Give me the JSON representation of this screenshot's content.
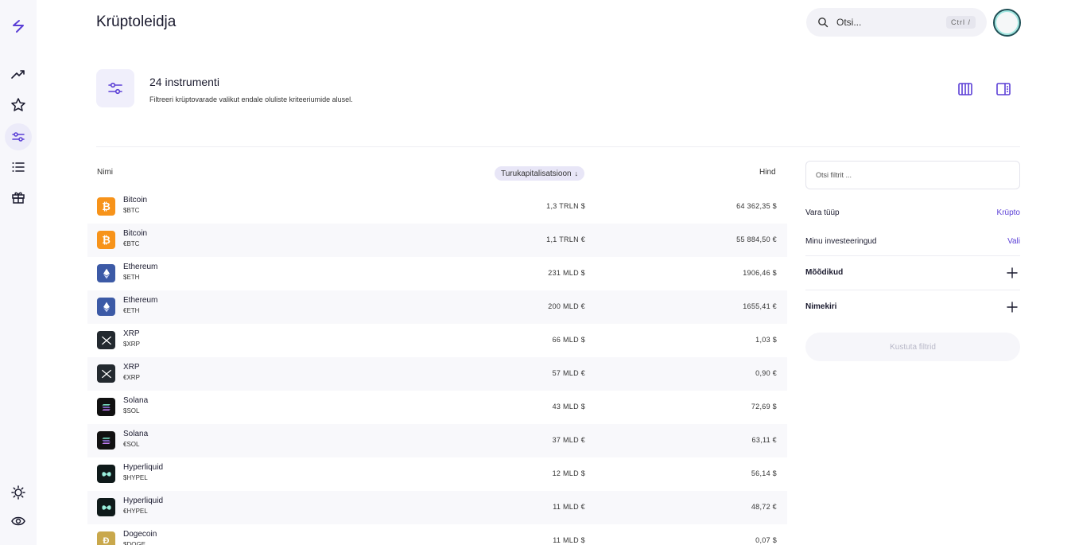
{
  "header": {
    "title": "Krüptoleidja",
    "search_placeholder": "Otsi...",
    "search_shortcut": "Ctrl  /"
  },
  "sidebar": {
    "items": [
      {
        "name": "trending-icon"
      },
      {
        "name": "star-icon"
      },
      {
        "name": "sliders-icon",
        "active": true
      },
      {
        "name": "list-icon"
      },
      {
        "name": "gift-icon"
      }
    ],
    "bottom": [
      {
        "name": "sun-icon"
      },
      {
        "name": "eye-icon"
      }
    ]
  },
  "intro": {
    "title": "24 instrumenti",
    "subtitle": "Filtreeri krüptovarade valikut endale oluliste kriteeriumide alusel."
  },
  "table": {
    "columns": {
      "name": "Nimi",
      "market_cap": "Turukapitalisatsioon",
      "sort_arrow": "↓",
      "price": "Hind"
    },
    "rows": [
      {
        "name": "Bitcoin",
        "ticker": "$BTC",
        "market_cap": "1,3 TRLN $",
        "price": "64 362,35 $",
        "icon": "bitcoin-icon",
        "color": "#f7931a"
      },
      {
        "name": "Bitcoin",
        "ticker": "€BTC",
        "market_cap": "1,1 TRLN €",
        "price": "55 884,50 €",
        "icon": "bitcoin-icon",
        "color": "#f7931a"
      },
      {
        "name": "Ethereum",
        "ticker": "$ETH",
        "market_cap": "231 MLD $",
        "price": "1906,46 $",
        "icon": "ethereum-icon",
        "color": "#3c5aa6"
      },
      {
        "name": "Ethereum",
        "ticker": "€ETH",
        "market_cap": "200 MLD €",
        "price": "1655,41 €",
        "icon": "ethereum-icon",
        "color": "#3c5aa6"
      },
      {
        "name": "XRP",
        "ticker": "$XRP",
        "market_cap": "66 MLD $",
        "price": "1,03 $",
        "icon": "xrp-icon",
        "color": "#23292f"
      },
      {
        "name": "XRP",
        "ticker": "€XRP",
        "market_cap": "57 MLD €",
        "price": "0,90 €",
        "icon": "xrp-icon",
        "color": "#23292f"
      },
      {
        "name": "Solana",
        "ticker": "$SOL",
        "market_cap": "43 MLD $",
        "price": "72,69 $",
        "icon": "solana-icon",
        "color": "#111111"
      },
      {
        "name": "Solana",
        "ticker": "€SOL",
        "market_cap": "37 MLD €",
        "price": "63,11 €",
        "icon": "solana-icon",
        "color": "#111111"
      },
      {
        "name": "Hyperliquid",
        "ticker": "$HYPEL",
        "market_cap": "12 MLD $",
        "price": "56,14 $",
        "icon": "hyperliquid-icon",
        "color": "#0f1a1a"
      },
      {
        "name": "Hyperliquid",
        "ticker": "€HYPEL",
        "market_cap": "11 MLD €",
        "price": "48,72 €",
        "icon": "hyperliquid-icon",
        "color": "#0f1a1a"
      },
      {
        "name": "Dogecoin",
        "ticker": "$DOGE",
        "market_cap": "11 MLD $",
        "price": "0,07 $",
        "icon": "dogecoin-icon",
        "color": "#c9a84c"
      }
    ]
  },
  "filters": {
    "search_placeholder": "Otsi filtrit ...",
    "asset_type_label": "Vara tüüp",
    "asset_type_value": "Krüpto",
    "my_investments_label": "Minu investeeringud",
    "my_investments_value": "Vali",
    "metrics_label": "Mõõdikud",
    "list_label": "Nimekiri",
    "clear_label": "Kustuta filtrid"
  },
  "colors": {
    "accent": "#5b3fd6",
    "sidebar_bg": "#f7f7fb",
    "row_alt": "#f8f8fb"
  }
}
